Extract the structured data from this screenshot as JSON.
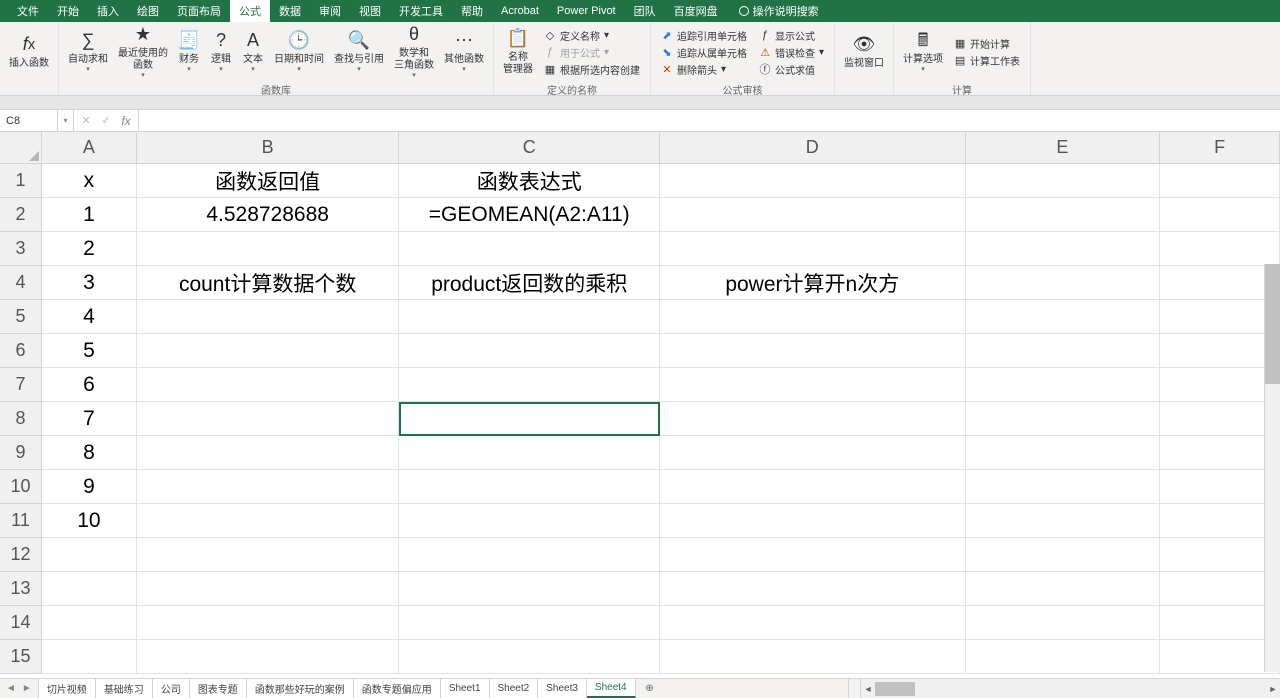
{
  "tabs": [
    "文件",
    "开始",
    "插入",
    "绘图",
    "页面布局",
    "公式",
    "数据",
    "审阅",
    "视图",
    "开发工具",
    "帮助",
    "Acrobat",
    "Power Pivot",
    "团队",
    "百度网盘"
  ],
  "active_tab_index": 5,
  "tell_me": "操作说明搜索",
  "ribbon": {
    "insert_function": "插入函数",
    "autosum": "自动求和",
    "recent": "最近使用的\n函数",
    "financial": "财务",
    "logical": "逻辑",
    "text": "文本",
    "datetime": "日期和时间",
    "lookup": "查找与引用",
    "math": "数学和\n三角函数",
    "more": "其他函数",
    "group_lib": "函数库",
    "name_manager": "名称\n管理器",
    "define_name": "定义名称",
    "use_in_formula": "用于公式",
    "create_from_sel": "根据所选内容创建",
    "group_names": "定义的名称",
    "trace_prec": "追踪引用单元格",
    "trace_dep": "追踪从属单元格",
    "remove_arrows": "删除箭头",
    "show_formulas": "显示公式",
    "error_check": "错误检查",
    "eval_formula": "公式求值",
    "group_audit": "公式审核",
    "watch": "监视窗口",
    "calc_options": "计算选项",
    "calc_now": "开始计算",
    "calc_sheet": "计算工作表",
    "group_calc": "计算"
  },
  "name_box": "C8",
  "formula": "",
  "columns": [
    "A",
    "B",
    "C",
    "D",
    "E",
    "F"
  ],
  "rows": [
    "1",
    "2",
    "3",
    "4",
    "5",
    "6",
    "7",
    "8",
    "9",
    "10",
    "11",
    "12",
    "13",
    "14",
    "15"
  ],
  "cells": {
    "A1": "x",
    "B1": "函数返回值",
    "C1": "函数表达式",
    "A2": "1",
    "B2": "4.528728688",
    "C2": "=GEOMEAN(A2:A11)",
    "A3": "2",
    "A4": "3",
    "B4": "count计算数据个数",
    "C4": "product返回数的乘积",
    "D4": "power计算开n次方",
    "A5": "4",
    "A6": "5",
    "A7": "6",
    "A8": "7",
    "A9": "8",
    "A10": "9",
    "A11": "10"
  },
  "selected_cell": "C8",
  "sheet_tabs": [
    "切片视频",
    "基础练习",
    "公司",
    "图表专题",
    "函数那些好玩的案例",
    "函数专题偏应用",
    "Sheet1",
    "Sheet2",
    "Sheet3",
    "Sheet4"
  ],
  "active_sheet_index": 9
}
